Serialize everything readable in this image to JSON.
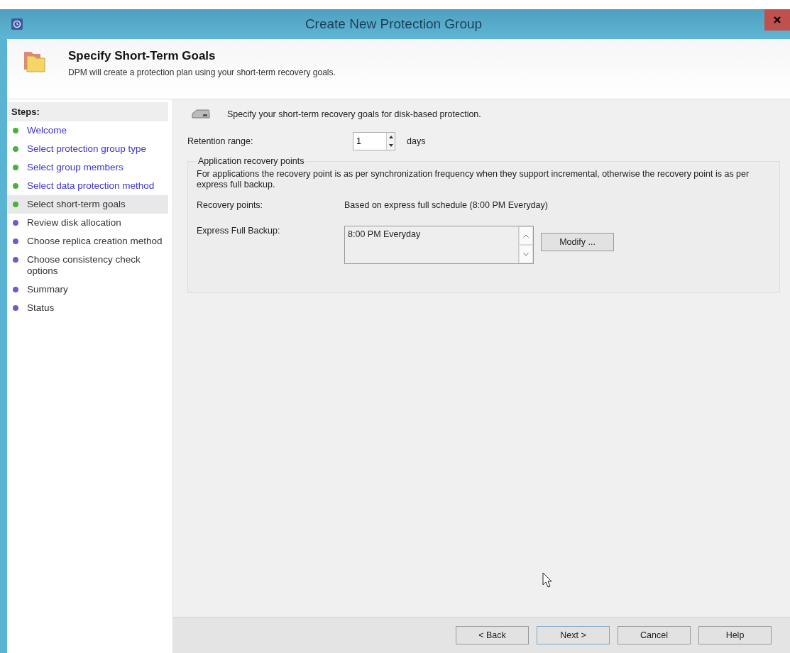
{
  "window": {
    "title": "Create New Protection Group"
  },
  "header": {
    "title": "Specify Short-Term Goals",
    "subtitle": "DPM will create a protection plan using your short-term recovery goals."
  },
  "steps": {
    "heading": "Steps:",
    "items": [
      {
        "label": "Welcome",
        "completed": true,
        "selected": false
      },
      {
        "label": "Select protection group type",
        "completed": true,
        "selected": false
      },
      {
        "label": "Select group members",
        "completed": true,
        "selected": false
      },
      {
        "label": "Select data protection method",
        "completed": true,
        "selected": false
      },
      {
        "label": "Select short-term goals",
        "completed": true,
        "selected": true
      },
      {
        "label": "Review disk allocation",
        "completed": false,
        "selected": false
      },
      {
        "label": "Choose replica creation method",
        "completed": false,
        "selected": false
      },
      {
        "label": "Choose consistency check options",
        "completed": false,
        "selected": false
      },
      {
        "label": "Summary",
        "completed": false,
        "selected": false
      },
      {
        "label": "Status",
        "completed": false,
        "selected": false
      }
    ]
  },
  "content": {
    "intro": "Specify your short-term recovery goals for disk-based protection.",
    "retention": {
      "label": "Retention range:",
      "value": "1",
      "unit": "days"
    },
    "group": {
      "title": "Application recovery points",
      "description": "For applications the recovery point is as per synchronization frequency when they support incremental, otherwise the recovery point is as per express full backup.",
      "recovery_points": {
        "label": "Recovery points:",
        "value": "Based on express full schedule (8:00 PM Everyday)"
      },
      "express_full_backup": {
        "label": "Express Full Backup:",
        "items": [
          "8:00 PM Everyday"
        ],
        "button": "Modify ..."
      }
    }
  },
  "buttons": [
    {
      "label": "< Back",
      "default": false
    },
    {
      "label": "Next >",
      "default": true
    },
    {
      "label": "Cancel",
      "default": false
    },
    {
      "label": "Help",
      "default": false
    }
  ]
}
